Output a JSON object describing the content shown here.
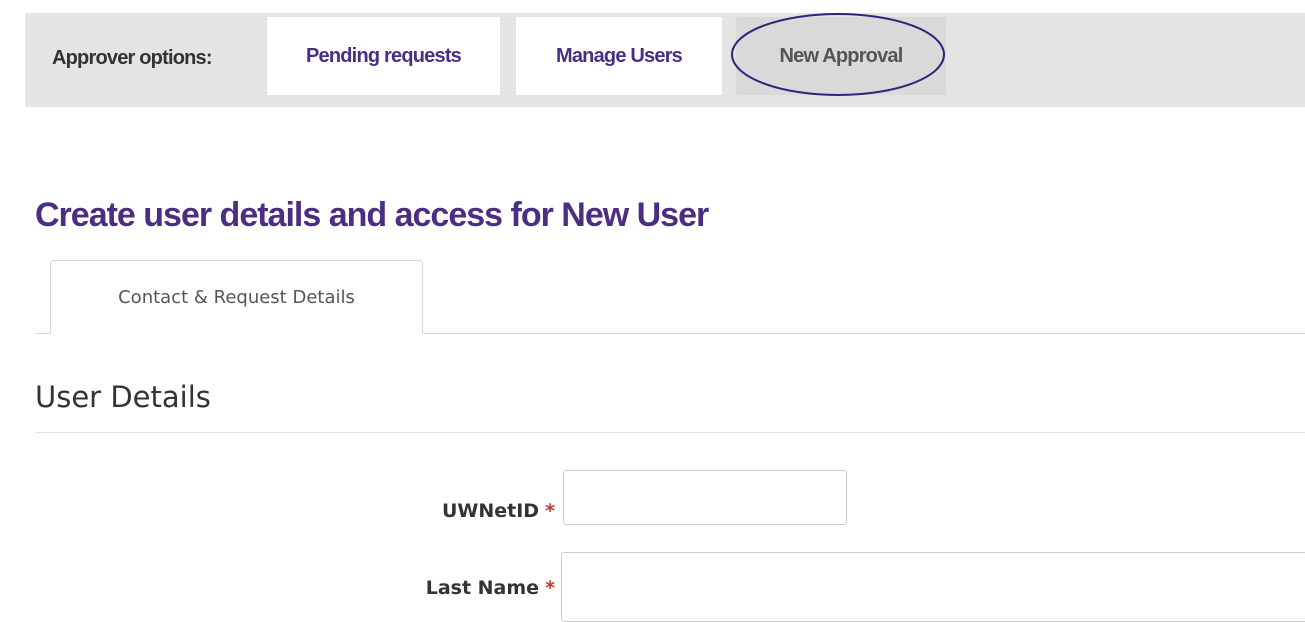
{
  "approver_options": {
    "label": "Approver options:",
    "tabs": [
      {
        "label": "Pending requests",
        "active": false
      },
      {
        "label": "Manage Users",
        "active": false
      },
      {
        "label": "New Approval",
        "active": true,
        "highlighted": true
      }
    ]
  },
  "page": {
    "title": "Create user details and access for New User"
  },
  "content_tabs": [
    {
      "label": "Contact & Request Details",
      "active": true
    }
  ],
  "section": {
    "title": "User Details"
  },
  "form": {
    "required_marker": "*",
    "fields": [
      {
        "label": "UWNetID",
        "value": "",
        "required": true
      },
      {
        "label": "Last Name",
        "value": "",
        "required": true
      }
    ]
  },
  "colors": {
    "brand_purple": "#4b2e83",
    "bar_background": "#e4e4e4",
    "required_red": "#c0392b",
    "highlight_ellipse": "#3a1f78"
  }
}
